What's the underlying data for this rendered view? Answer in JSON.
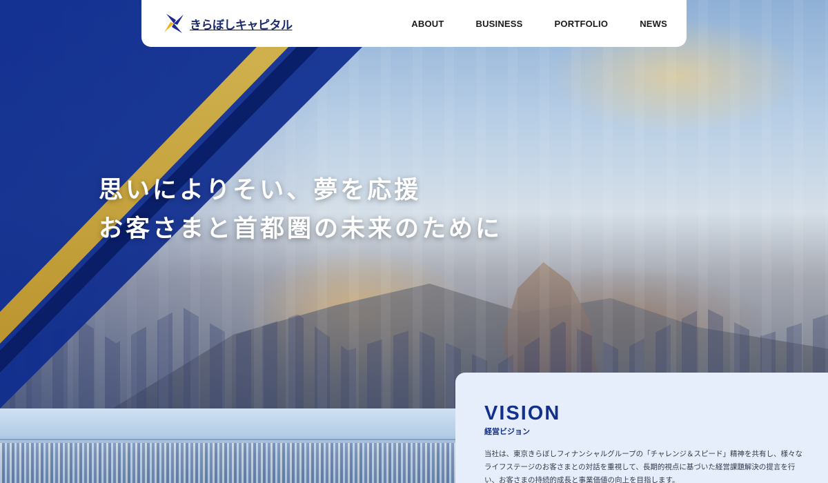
{
  "header": {
    "logo_text": "きらぼしキャピタル",
    "nav": [
      {
        "label": "ABOUT"
      },
      {
        "label": "BUSINESS"
      },
      {
        "label": "PORTFOLIO"
      },
      {
        "label": "NEWS"
      }
    ]
  },
  "hero": {
    "line1": "思いによりそい、夢を応援",
    "line2": "お客さまと首都圏の未来のために"
  },
  "vision": {
    "title": "VISION",
    "subtitle": "経営ビジョン",
    "body": "当社は、東京きらぼしフィナンシャルグループの「チャレンジ＆スピード」精神を共有し、様々なライフステージのお客さまとの対話を重視して、長期的視点に基づいた経営課題解決の提言を行い、お客さまの持続的成長と事業価値の向上を目指します。"
  },
  "colors": {
    "brand_navy": "#13308c",
    "band_blue": "#0c2a8e",
    "band_gold": "#e7c34a",
    "panel_bg": "#e6eefb"
  },
  "icons": {
    "logo": "kiraboshi-star-icon"
  }
}
